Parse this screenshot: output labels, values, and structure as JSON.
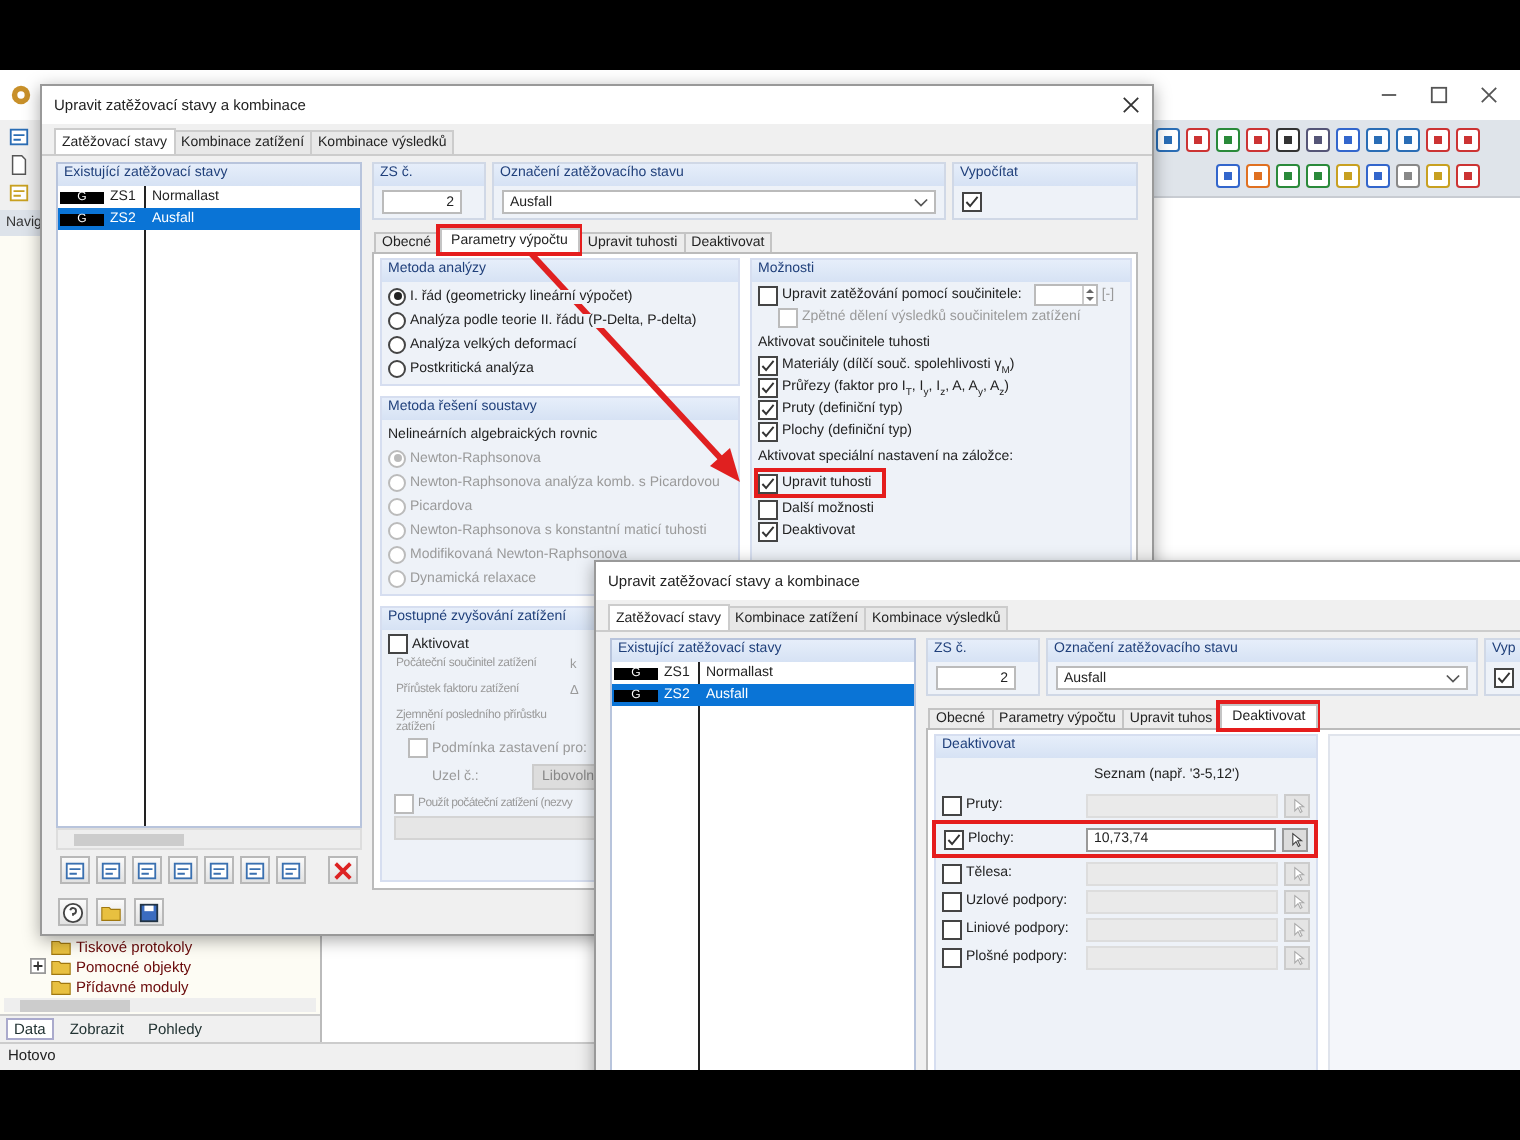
{
  "background_app": {
    "navigator_label": "Navig",
    "tree": [
      {
        "label": "Tiskové protokoly",
        "expandable": false
      },
      {
        "label": "Pomocné objekty",
        "expandable": true
      },
      {
        "label": "Přídavné moduly",
        "expandable": false
      }
    ],
    "nav_tabs": [
      {
        "label": "Data",
        "selected": true
      },
      {
        "label": "Zobrazit",
        "selected": false
      },
      {
        "label": "Pohledy",
        "selected": false
      }
    ],
    "status_bar": "Hotovo"
  },
  "dialog_1": {
    "title": "Upravit zatěžovací stavy a kombinace",
    "tabs": [
      {
        "label": "Zatěžovací stavy",
        "selected": true
      },
      {
        "label": "Kombinace zatížení",
        "selected": false
      },
      {
        "label": "Kombinace výsledků",
        "selected": false
      }
    ],
    "load_cases": {
      "header": "Existující zatěžovací stavy",
      "rows": [
        {
          "tag": "G",
          "number": "ZS1",
          "name": "Normallast",
          "selected": false
        },
        {
          "tag": "G",
          "number": "ZS2",
          "name": "Ausfall",
          "selected": true
        }
      ]
    },
    "number": {
      "label": "ZS č.",
      "value": "2"
    },
    "designation": {
      "label": "Označení zatěžovacího stavu",
      "value": "Ausfall"
    },
    "calculate": {
      "label": "Vypočítat",
      "checked": true
    },
    "subtabs": [
      {
        "label": "Obecné",
        "selected": false,
        "highlighted": false
      },
      {
        "label": "Parametry výpočtu",
        "selected": true,
        "highlighted": true
      },
      {
        "label": "Upravit tuhosti",
        "selected": false,
        "highlighted": false
      },
      {
        "label": "Deaktivovat",
        "selected": false,
        "highlighted": false
      }
    ],
    "analysis_method": {
      "title": "Metoda analýzy",
      "options": [
        {
          "label": "I. řád (geometricky lineární výpočet)",
          "selected": true,
          "disabled": false
        },
        {
          "label": "Analýza podle teorie II. řádu (P-Delta, P-delta)",
          "selected": false,
          "disabled": false
        },
        {
          "label": "Analýza velkých deformací",
          "selected": false,
          "disabled": false
        },
        {
          "label": "Postkritická analýza",
          "selected": false,
          "disabled": false
        }
      ]
    },
    "solver": {
      "title": "Metoda řešení soustavy",
      "subtitle": "Nelineárních algebraických rovnic",
      "options": [
        {
          "label": "Newton-Raphsonova",
          "selected": true,
          "disabled": true
        },
        {
          "label": "Newton-Raphsonova analýza komb. s Picardovou",
          "selected": false,
          "disabled": true
        },
        {
          "label": "Picardova",
          "selected": false,
          "disabled": true
        },
        {
          "label": "Newton-Raphsonova s konstantní maticí tuhosti",
          "selected": false,
          "disabled": true
        },
        {
          "label": "Modifikovaná Newton-Raphsonova",
          "selected": false,
          "disabled": true
        },
        {
          "label": "Dynamická relaxace",
          "selected": false,
          "disabled": true
        }
      ]
    },
    "progressive_loading": {
      "title": "Postupné zvyšování zatížení",
      "activate": {
        "label": "Aktivovat",
        "checked": false
      },
      "parameters": [
        {
          "label": "Počáteční součinitel zatížení",
          "unit": "k"
        },
        {
          "label": "Přírůstek faktoru zatížení",
          "unit": "Δ"
        },
        {
          "label": "Zjemnění posledního přírůstku zatížení"
        }
      ],
      "stop_condition": {
        "label": "Podmínka zastavení pro:",
        "checked": false
      },
      "node": {
        "label": "Uzel č.:",
        "value": "Libovoln"
      },
      "initial_load": {
        "label": "Použít počáteční zatížení (nezvy",
        "checked": false
      }
    },
    "options": {
      "title": "Možnosti",
      "factor": {
        "label": "Upravit zatěžování pomocí součinitele:",
        "checked": false,
        "unit": "[-]"
      },
      "back_division": {
        "label": "Zpětné dělení výsledků součinitelem zatížení",
        "checked": false,
        "disabled": true
      },
      "stiffness_title": "Aktivovat součinitele tuhosti",
      "stiffness": [
        {
          "label": "Materiály (dílčí souč. spolehlivosti γ$_{M}$)",
          "checked": true
        },
        {
          "label": "Průřezy (faktor pro I$_{T}$, I$_{y}$, I$_{z}$, A, A$_{y}$, A$_{z}$)",
          "checked": true
        },
        {
          "label": "Pruty (definiční typ)",
          "checked": true
        },
        {
          "label": "Plochy (definiční typ)",
          "checked": true
        }
      ],
      "special_title": "Aktivovat speciální nastavení na záložce:",
      "special": [
        {
          "label": "Upravit tuhosti",
          "checked": true,
          "highlighted": true
        },
        {
          "label": "Další možnosti",
          "checked": false,
          "highlighted": false
        },
        {
          "label": "Deaktivovat",
          "checked": true,
          "highlighted": false
        }
      ]
    }
  },
  "dialog_2": {
    "title": "Upravit zatěžovací stavy a kombinace",
    "tabs": [
      {
        "label": "Zatěžovací stavy",
        "selected": true
      },
      {
        "label": "Kombinace zatížení",
        "selected": false
      },
      {
        "label": "Kombinace výsledků",
        "selected": false
      }
    ],
    "load_cases": {
      "header": "Existující zatěžovací stavy",
      "rows": [
        {
          "tag": "G",
          "number": "ZS1",
          "name": "Normallast",
          "selected": false
        },
        {
          "tag": "G",
          "number": "ZS2",
          "name": "Ausfall",
          "selected": true
        }
      ]
    },
    "number": {
      "label": "ZS č.",
      "value": "2"
    },
    "designation": {
      "label": "Označení zatěžovacího stavu",
      "value": "Ausfall"
    },
    "calculate": {
      "label": "Vyp",
      "checked": true
    },
    "subtabs": [
      {
        "label": "Obecné",
        "selected": false,
        "highlighted": false
      },
      {
        "label": "Parametry výpočtu",
        "selected": false,
        "highlighted": false
      },
      {
        "label": "Upravit tuhos",
        "selected": false,
        "highlighted": false
      },
      {
        "label": "Deaktivovat",
        "selected": true,
        "highlighted": true
      }
    ],
    "deactivate": {
      "title": "Deaktivovat",
      "list_hint": "Seznam (např. '3-5,12')",
      "rows": [
        {
          "label": "Pruty:",
          "checked": false,
          "highlighted": false
        },
        {
          "label": "Plochy:",
          "checked": true,
          "value": "10,73,74",
          "highlighted": true
        },
        {
          "label": "Tělesa:",
          "checked": false,
          "highlighted": false
        },
        {
          "label": "Uzlové podpory:",
          "checked": false,
          "highlighted": false
        },
        {
          "label": "Liniové podpory:",
          "checked": false,
          "highlighted": false
        },
        {
          "label": "Plošné podpory:",
          "checked": false,
          "highlighted": false
        }
      ]
    }
  }
}
